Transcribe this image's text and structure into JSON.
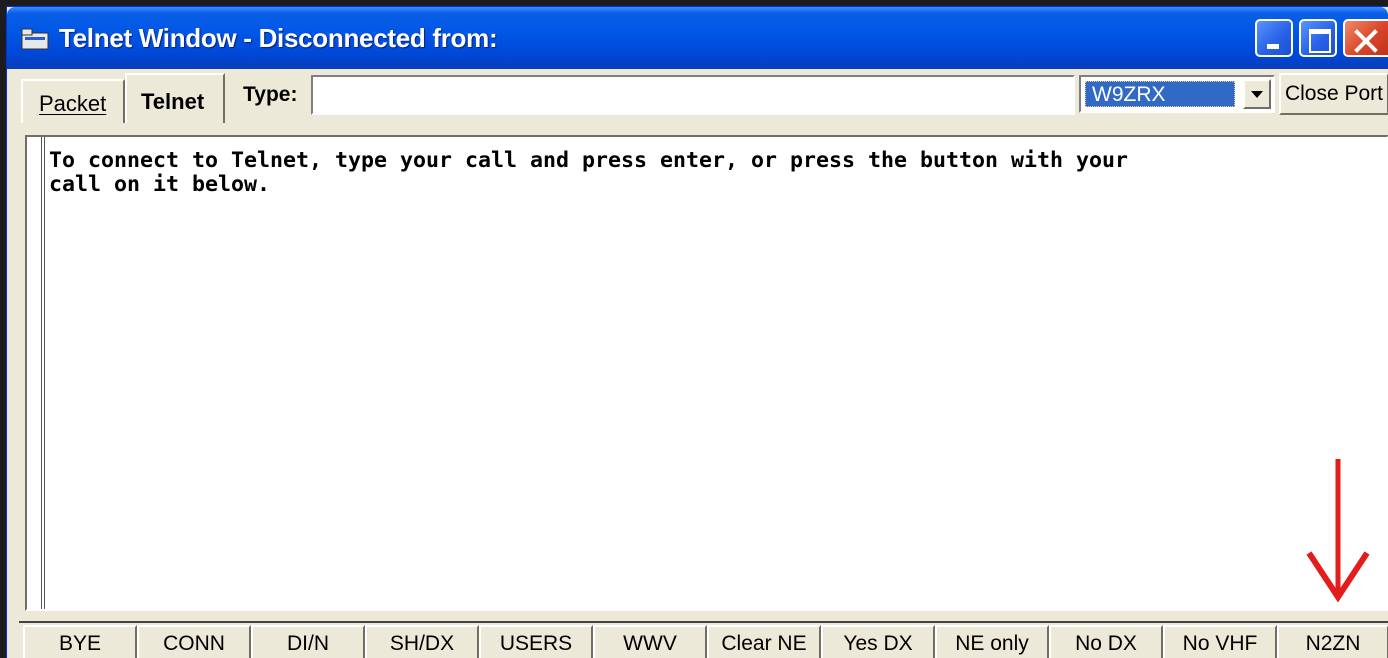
{
  "window": {
    "title": "Telnet Window - Disconnected from:"
  },
  "toolbar": {
    "tabs": [
      {
        "label": "Packet",
        "active": false
      },
      {
        "label": "Telnet",
        "active": true
      }
    ],
    "type_label": "Type:",
    "type_value": "",
    "callsign_selected": "W9ZRX",
    "close_port_label": "Close Port"
  },
  "output": {
    "lines": [
      "To connect to Telnet, type your call and press enter, or press the button with your",
      "call on it below."
    ]
  },
  "annotation": {
    "arrow_color": "#e31c1c",
    "arrow_direction": "down"
  },
  "function_buttons": [
    {
      "label": "BYE"
    },
    {
      "label": "CONN"
    },
    {
      "label": "DI/N"
    },
    {
      "label": "SH/DX"
    },
    {
      "label": "USERS"
    },
    {
      "label": "WWV"
    },
    {
      "label": "Clear NE"
    },
    {
      "label": "Yes DX"
    },
    {
      "label": "NE only"
    },
    {
      "label": "No DX"
    },
    {
      "label": "No VHF"
    },
    {
      "label": "N2ZN"
    }
  ],
  "colors": {
    "titlebar": "#0055e5",
    "window_bg": "#ece9d8",
    "selection": "#316ac5"
  }
}
